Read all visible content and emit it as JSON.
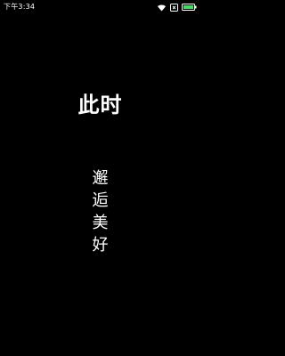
{
  "status_bar": {
    "time": "下午3:34",
    "icons": [
      "wifi-icon",
      "sim-off-icon",
      "battery-icon"
    ],
    "battery_color": "#4cd964"
  },
  "main": {
    "headline": "此时",
    "vertical_chars": [
      "邂",
      "逅",
      "美",
      "好"
    ]
  },
  "colors": {
    "background": "#000000",
    "text": "#ffffff"
  }
}
